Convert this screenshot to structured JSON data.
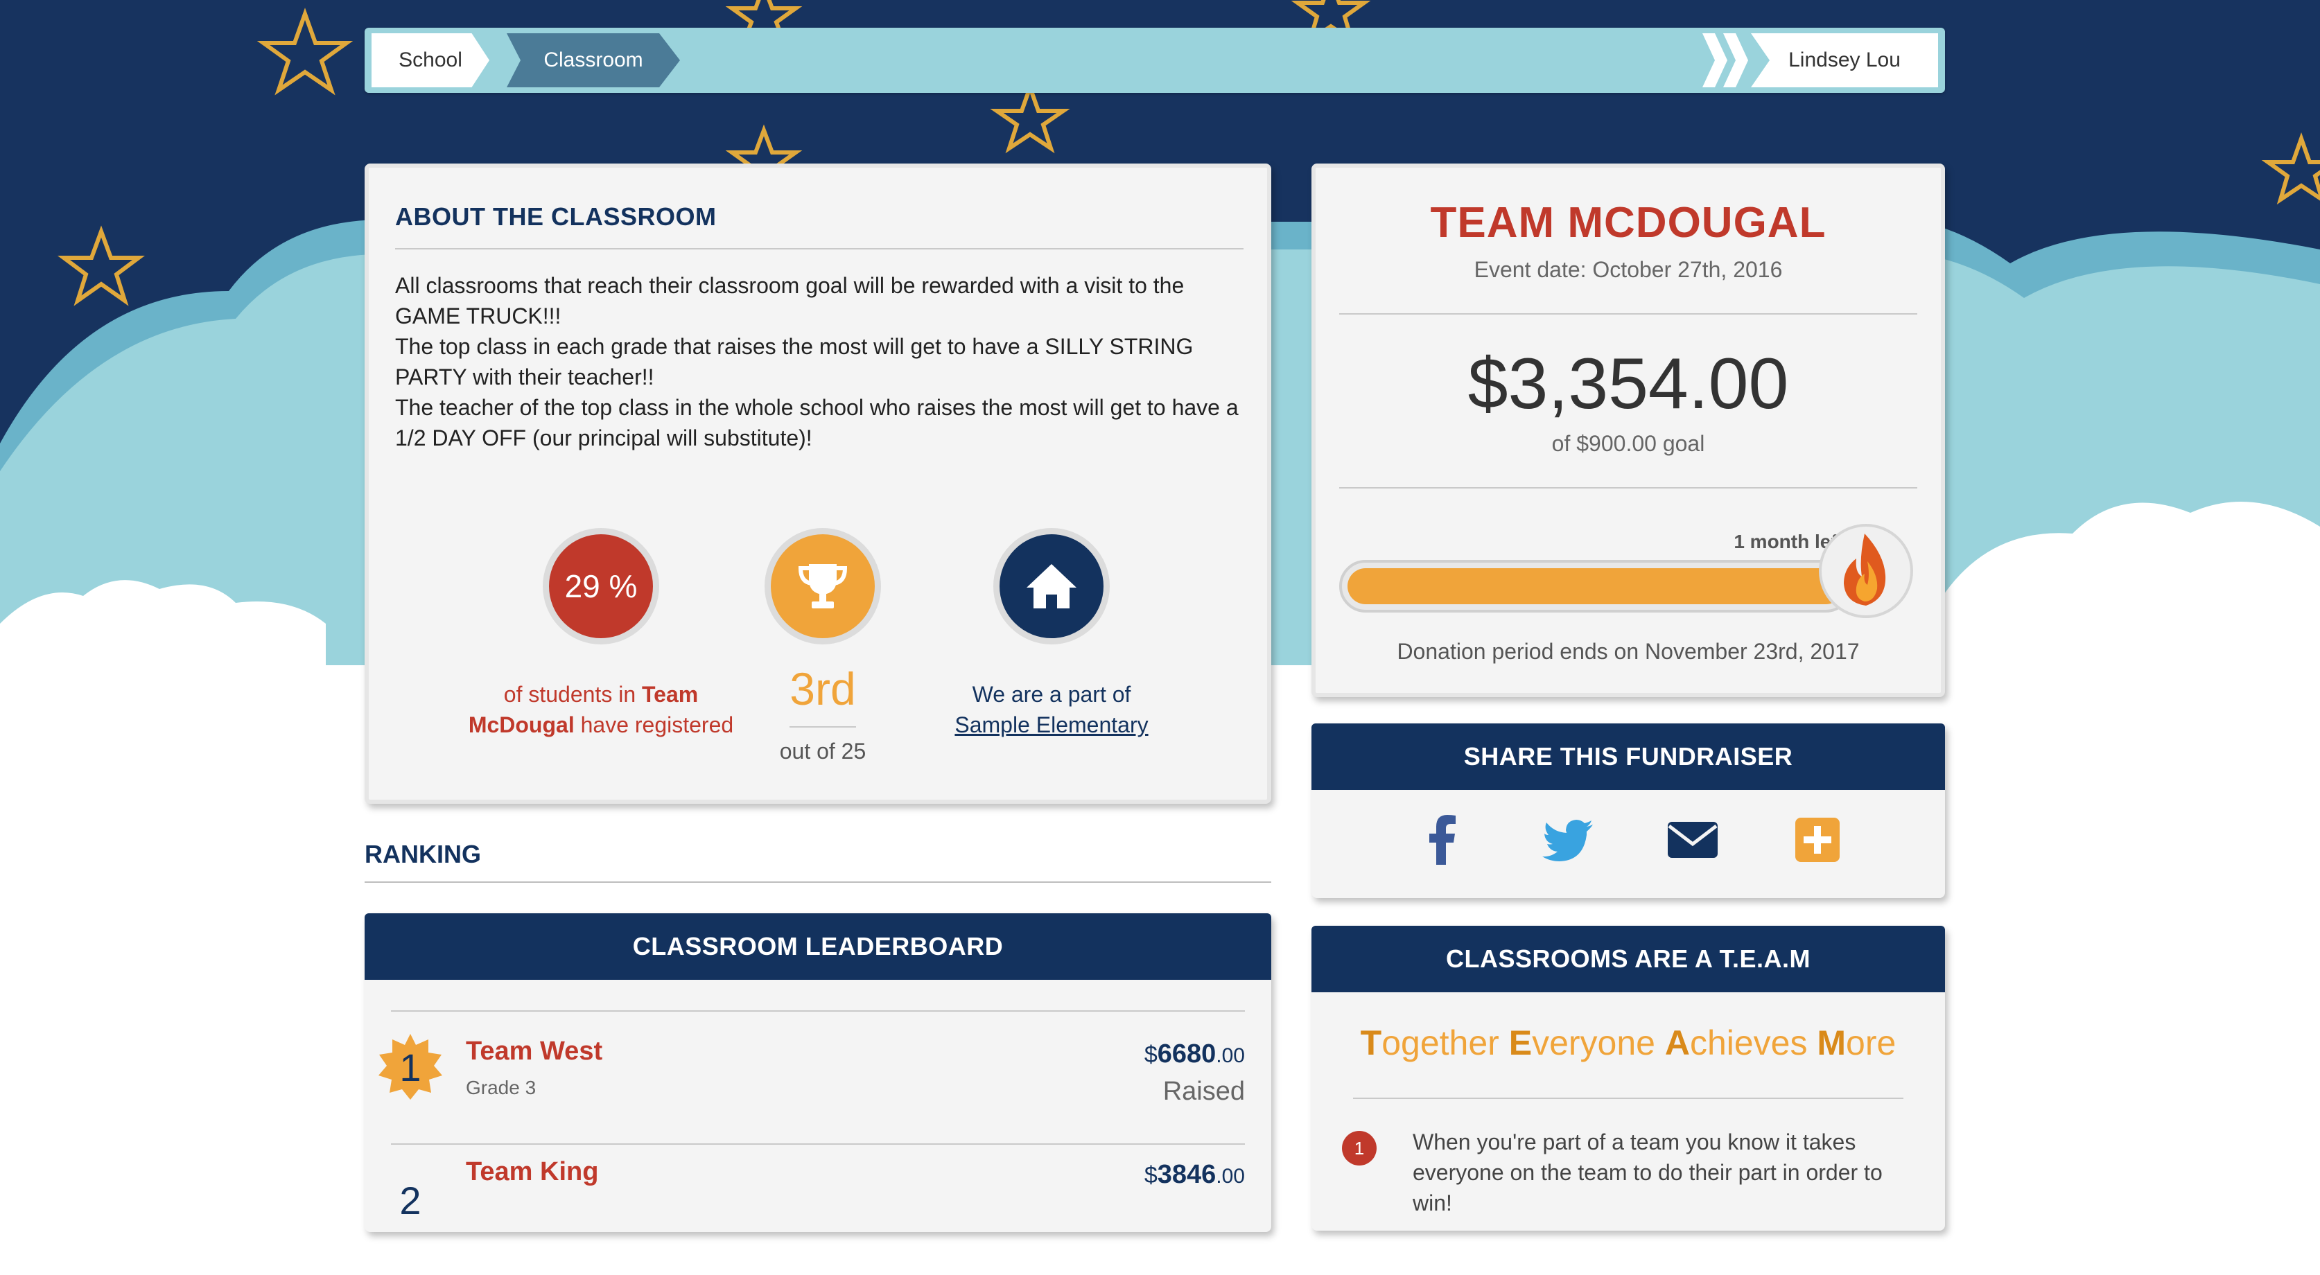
{
  "breadcrumb": {
    "school": "School",
    "classroom": "Classroom",
    "user": "Lindsey Lou"
  },
  "about": {
    "title": "ABOUT THE CLASSROOM",
    "paragraphs": [
      "All classrooms that reach their classroom goal will be rewarded with a visit to the GAME TRUCK!!!",
      "The top class in each grade that raises the most will get to have a SILLY STRING PARTY with their teacher!!",
      "The teacher of the top class in the whole school who raises the most will get to have a 1/2 DAY OFF (our principal will substitute)!"
    ],
    "stats": {
      "registered_pct": "29 %",
      "registered_caption_pre": "of students in ",
      "registered_team": "Team McDougal",
      "registered_caption_post": " have registered",
      "rank": "3rd",
      "rank_sub": "out of 25",
      "school_caption": "We are a part of",
      "school_link": "Sample Elementary"
    }
  },
  "ranking": {
    "title": "RANKING",
    "leaderboard_title": "CLASSROOM LEADERBOARD",
    "rows": [
      {
        "rank": "1",
        "name": "Team West",
        "grade": "Grade 3",
        "currency": "$",
        "amount": "6680",
        "cents": ".00",
        "status": "Raised"
      },
      {
        "rank": "2",
        "name": "Team King",
        "grade": "",
        "currency": "$",
        "amount": "3846",
        "cents": ".00",
        "status": ""
      }
    ]
  },
  "team": {
    "name": "TEAM MCDOUGAL",
    "event_date": "Event date: October 27th, 2016",
    "raised": "$3,354.00",
    "goal": "of $900.00 goal",
    "time_left": "1 month left",
    "progress_fraction": 1.0,
    "period_end": "Donation period ends on November 23rd, 2017"
  },
  "share": {
    "title": "SHARE THIS FUNDRAISER",
    "icons": [
      "facebook-icon",
      "twitter-icon",
      "email-icon",
      "plus-icon"
    ]
  },
  "team_card": {
    "title": "CLASSROOMS ARE A T.E.A.M",
    "acronym": [
      {
        "cap": "T",
        "rest": "ogether "
      },
      {
        "cap": "E",
        "rest": "veryone "
      },
      {
        "cap": "A",
        "rest": "chieves "
      },
      {
        "cap": "M",
        "rest": "ore"
      }
    ],
    "bullet_number": "1",
    "bullet_text": "When you're part of a team you know it takes everyone on the team to do their part in order to win!"
  },
  "colors": {
    "navy": "#13325e",
    "red": "#c0392b",
    "orange": "#f0a43a",
    "sky": "#17335f",
    "cloud": "#9ad3dc"
  }
}
